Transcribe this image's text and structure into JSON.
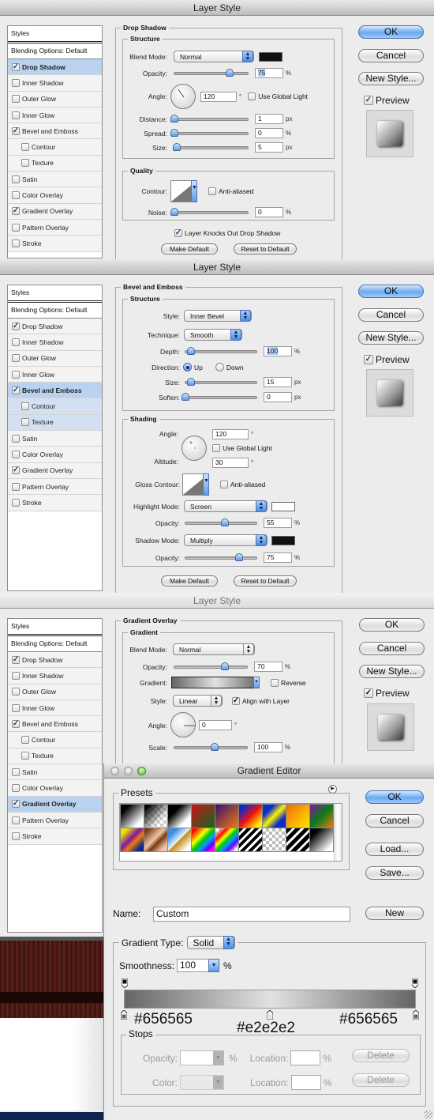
{
  "style_list": {
    "header": "Styles",
    "blending": "Blending Options: Default",
    "items": [
      {
        "label": "Drop Shadow",
        "checked": true
      },
      {
        "label": "Inner Shadow",
        "checked": false
      },
      {
        "label": "Outer Glow",
        "checked": false
      },
      {
        "label": "Inner Glow",
        "checked": false
      },
      {
        "label": "Bevel and Emboss",
        "checked": true
      },
      {
        "label": "Contour",
        "checked": false
      },
      {
        "label": "Texture",
        "checked": false
      },
      {
        "label": "Satin",
        "checked": false
      },
      {
        "label": "Color Overlay",
        "checked": false
      },
      {
        "label": "Gradient Overlay",
        "checked": true
      },
      {
        "label": "Pattern Overlay",
        "checked": false
      },
      {
        "label": "Stroke",
        "checked": false
      }
    ]
  },
  "side_buttons": {
    "ok": "OK",
    "cancel": "Cancel",
    "new_style": "New Style...",
    "preview": "Preview",
    "preview_checked": true
  },
  "dialogs": [
    {
      "title": "Layer Style",
      "selected": "Drop Shadow",
      "section": "Drop Shadow",
      "structure_label": "Structure",
      "blend_mode_label": "Blend Mode:",
      "blend_mode": "Normal",
      "blend_color": "#111111",
      "opacity_label": "Opacity:",
      "opacity": "75",
      "angle_label": "Angle:",
      "angle": "120",
      "global_light": "Use Global Light",
      "distance_label": "Distance:",
      "distance": "1",
      "spread_label": "Spread:",
      "spread": "0",
      "size_label": "Size:",
      "size": "5",
      "quality_label": "Quality",
      "contour_label": "Contour:",
      "anti_aliased": "Anti-aliased",
      "noise_label": "Noise:",
      "noise": "0",
      "knockout": "Layer Knocks Out Drop Shadow",
      "make_default": "Make Default",
      "reset_default": "Reset to Default"
    },
    {
      "title": "Layer Style",
      "selected": "Bevel and Emboss",
      "section": "Bevel and Emboss",
      "structure_label": "Structure",
      "style_label": "Style:",
      "style": "Inner Bevel",
      "technique_label": "Technique:",
      "technique": "Smooth",
      "depth_label": "Depth:",
      "depth": "100",
      "direction_label": "Direction:",
      "dir_up": "Up",
      "dir_down": "Down",
      "size_label": "Size:",
      "size": "15",
      "soften_label": "Soften:",
      "soften": "0",
      "shading_label": "Shading",
      "angle_label": "Angle:",
      "angle": "120",
      "global_light": "Use Global Light",
      "altitude_label": "Altitude:",
      "altitude": "30",
      "gloss_label": "Gloss Contour:",
      "anti_aliased": "Anti-aliased",
      "highlight_label": "Highlight Mode:",
      "highlight_mode": "Screen",
      "highlight_color": "#ffffff",
      "hl_opacity_label": "Opacity:",
      "hl_opacity": "55",
      "shadow_label": "Shadow Mode:",
      "shadow_mode": "Multiply",
      "shadow_color": "#111111",
      "sh_opacity_label": "Opacity:",
      "sh_opacity": "75",
      "make_default": "Make Default",
      "reset_default": "Reset to Default"
    },
    {
      "title": "Layer Style",
      "selected": "Gradient Overlay",
      "section": "Gradient Overlay",
      "gradient_label": "Gradient",
      "blend_mode_label": "Blend Mode:",
      "blend_mode": "Normal",
      "opacity_label": "Opacity:",
      "opacity": "70",
      "gradient_field_label": "Gradient:",
      "reverse": "Reverse",
      "style_label": "Style:",
      "style": "Linear",
      "align": "Align with Layer",
      "angle_label": "Angle:",
      "angle": "0",
      "scale_label": "Scale:",
      "scale": "100"
    }
  ],
  "slider_values": {
    "d1_opacity": 0.75,
    "d1_distance": 0.0,
    "d1_spread": 0.0,
    "d1_size": 0.03,
    "d1_noise": 0.0,
    "d2_depth": 0.08,
    "d2_size": 0.08,
    "d2_soften": 0.0,
    "d2_hl": 0.55,
    "d2_sh": 0.75,
    "d3_opacity": 0.7,
    "d3_scale": 0.55
  },
  "gradient_editor": {
    "title": "Gradient Editor",
    "presets_label": "Presets",
    "ok": "OK",
    "cancel": "Cancel",
    "load": "Load...",
    "save": "Save...",
    "name_label": "Name:",
    "name": "Custom",
    "new": "New",
    "type_label": "Gradient Type:",
    "type": "Solid",
    "smoothness_label": "Smoothness:",
    "smoothness": "100",
    "pct": "%",
    "stops_label": "Stops",
    "stop_opacity_label": "Opacity:",
    "stop_color_label": "Color:",
    "location_label": "Location:",
    "delete": "Delete",
    "color_stops": [
      {
        "color": "#656565",
        "location": 0,
        "annotation": "#656565"
      },
      {
        "color": "#e2e2e2",
        "location": 50,
        "annotation": "#e2e2e2"
      },
      {
        "color": "#656565",
        "location": 100,
        "annotation": "#656565"
      }
    ]
  }
}
